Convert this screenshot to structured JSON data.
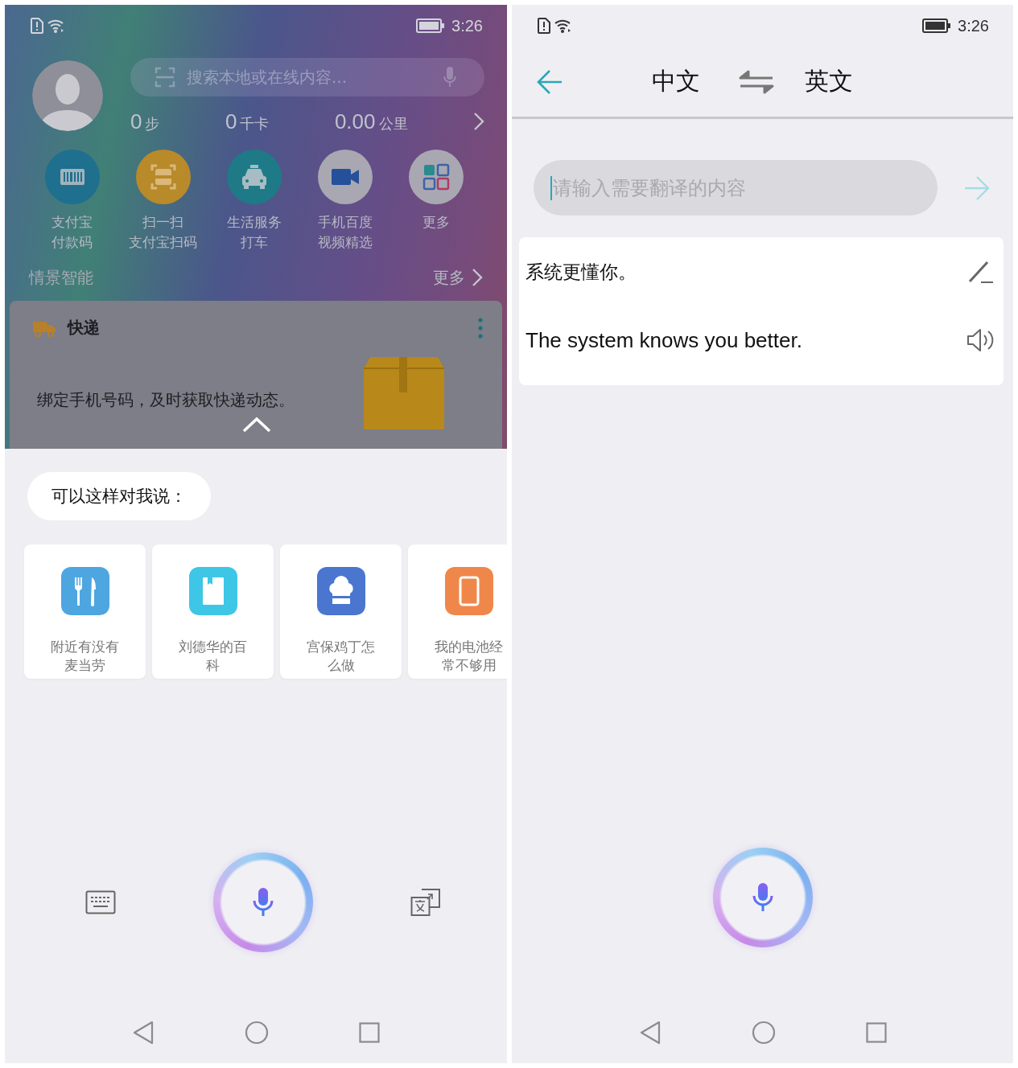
{
  "left_screen": {
    "status_bar": {
      "time": "3:26"
    },
    "search": {
      "placeholder": "搜索本地或在线内容..."
    },
    "stats": [
      {
        "value": "0",
        "unit": "步"
      },
      {
        "value": "0",
        "unit": "千卡"
      },
      {
        "value": "0.00",
        "unit": "公里"
      }
    ],
    "shortcuts": [
      {
        "kind": "barcode",
        "label": [
          "支付宝",
          "付款码"
        ]
      },
      {
        "kind": "scan",
        "label": [
          "扫一扫",
          "支付宝扫码"
        ]
      },
      {
        "kind": "taxi",
        "label": [
          "生活服务",
          "打车"
        ]
      },
      {
        "kind": "video",
        "label": [
          "手机百度",
          "视频精选"
        ]
      },
      {
        "kind": "apps",
        "label": [
          "更多"
        ]
      }
    ],
    "section": {
      "title": "情景智能",
      "more": "更多"
    },
    "card": {
      "title": "快递",
      "body": "绑定手机号码，及时获取快递动态。"
    },
    "prompt": "可以这样对我说：",
    "suggestions": [
      {
        "kind": "food",
        "label": [
          "附近有没有",
          "麦当劳"
        ]
      },
      {
        "kind": "book",
        "label": [
          "刘德华的百",
          "科"
        ]
      },
      {
        "kind": "chef",
        "label": [
          "宫保鸡丁怎",
          "么做"
        ]
      },
      {
        "kind": "phone",
        "label": [
          "我的电池经",
          "常不够用"
        ]
      }
    ]
  },
  "right_screen": {
    "status_bar": {
      "time": "3:26"
    },
    "source_language": "中文",
    "target_language": "英文",
    "input": {
      "placeholder": "请输入需要翻译的内容"
    },
    "result": {
      "source": "系统更懂你。",
      "translation": "The system knows you better."
    }
  }
}
